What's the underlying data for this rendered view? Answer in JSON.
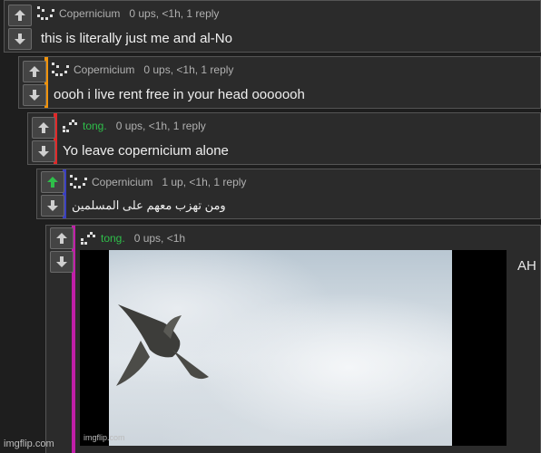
{
  "comments": [
    {
      "username": "Copernicium",
      "username_color": "#b0b0b0",
      "stats": "0 ups, <1h, 1 reply",
      "text": "this is literally just me and al-No",
      "bar_color": "",
      "upvoted": false
    },
    {
      "username": "Copernicium",
      "username_color": "#b0b0b0",
      "stats": "0 ups, <1h, 1 reply",
      "text": "oooh i live rent free in your head ooooooh",
      "bar_color": "#f0930c",
      "upvoted": false
    },
    {
      "username": "tong.",
      "username_color": "#2fbf4a",
      "stats": "0 ups, <1h, 1 reply",
      "text": "Yo leave copernicium alone",
      "bar_color": "#e02828",
      "upvoted": false
    },
    {
      "username": "Copernicium",
      "username_color": "#b0b0b0",
      "stats": "1 up, <1h, 1 reply",
      "text": "ومن تهزب معهم على المسلمين",
      "bar_color": "#3a3fbf",
      "upvoted": true
    },
    {
      "username": "tong.",
      "username_color": "#2fbf4a",
      "stats": "0 ups, <1h",
      "text": "",
      "bar_color": "#c01fa8",
      "upvoted": false
    }
  ],
  "image": {
    "watermark": "imgflip.com",
    "side_text": "AH"
  },
  "footer": {
    "site": "imgflip.com"
  },
  "colors": {
    "upvote_active": "#2fbf4a",
    "arrow": "#cfcfcf",
    "background": "#1e1e1e"
  },
  "icons": {
    "up": "arrow-up-icon",
    "down": "arrow-down-icon",
    "avatar": "pixel-avatar-icon"
  }
}
